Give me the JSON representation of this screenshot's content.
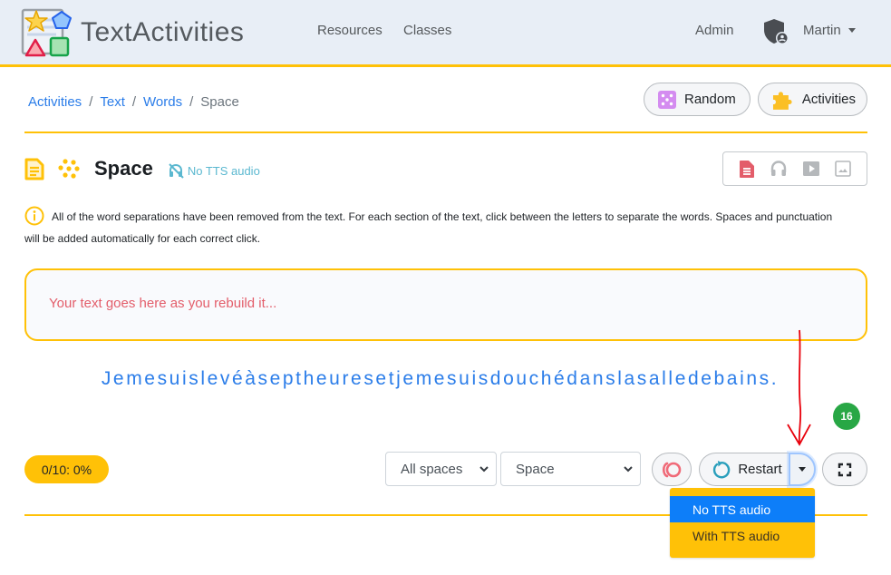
{
  "navbar": {
    "brand": "TextActivities",
    "links": [
      "Resources",
      "Classes"
    ],
    "admin_label": "Admin",
    "user_label": "Martin"
  },
  "breadcrumb": {
    "items": [
      "Activities",
      "Text",
      "Words"
    ],
    "current": "Space",
    "separator": "/"
  },
  "header_buttons": {
    "random_label": "Random",
    "activities_label": "Activities"
  },
  "activity": {
    "title": "Space",
    "tts_status": "No TTS audio",
    "instruction": "All of the word separations have been removed from the text. For each section of the text, click between the letters to separate the words. Spaces and punctuation will be added automatically for each correct click.",
    "rebuild_placeholder": "Your text goes here as you rebuild it...",
    "scrambled_text": "Jemesuislevéàseptheuresetjemesuisdouchédanslasalledebains.",
    "remaining_count": "16"
  },
  "controls": {
    "score": "0/10: 0%",
    "spaces_select": "All spaces",
    "mode_select": "Space",
    "restart_label": "Restart"
  },
  "dropdown": {
    "items": [
      {
        "label": "No TTS audio",
        "active": true
      },
      {
        "label": "With TTS audio",
        "active": false
      }
    ]
  },
  "colors": {
    "accent": "#ffc107",
    "link": "#2b7de9",
    "active_item": "#0d7ef9",
    "badge_green": "#28a745",
    "placeholder_red": "#e35d6a",
    "tts_teal": "#5bb8d0"
  }
}
